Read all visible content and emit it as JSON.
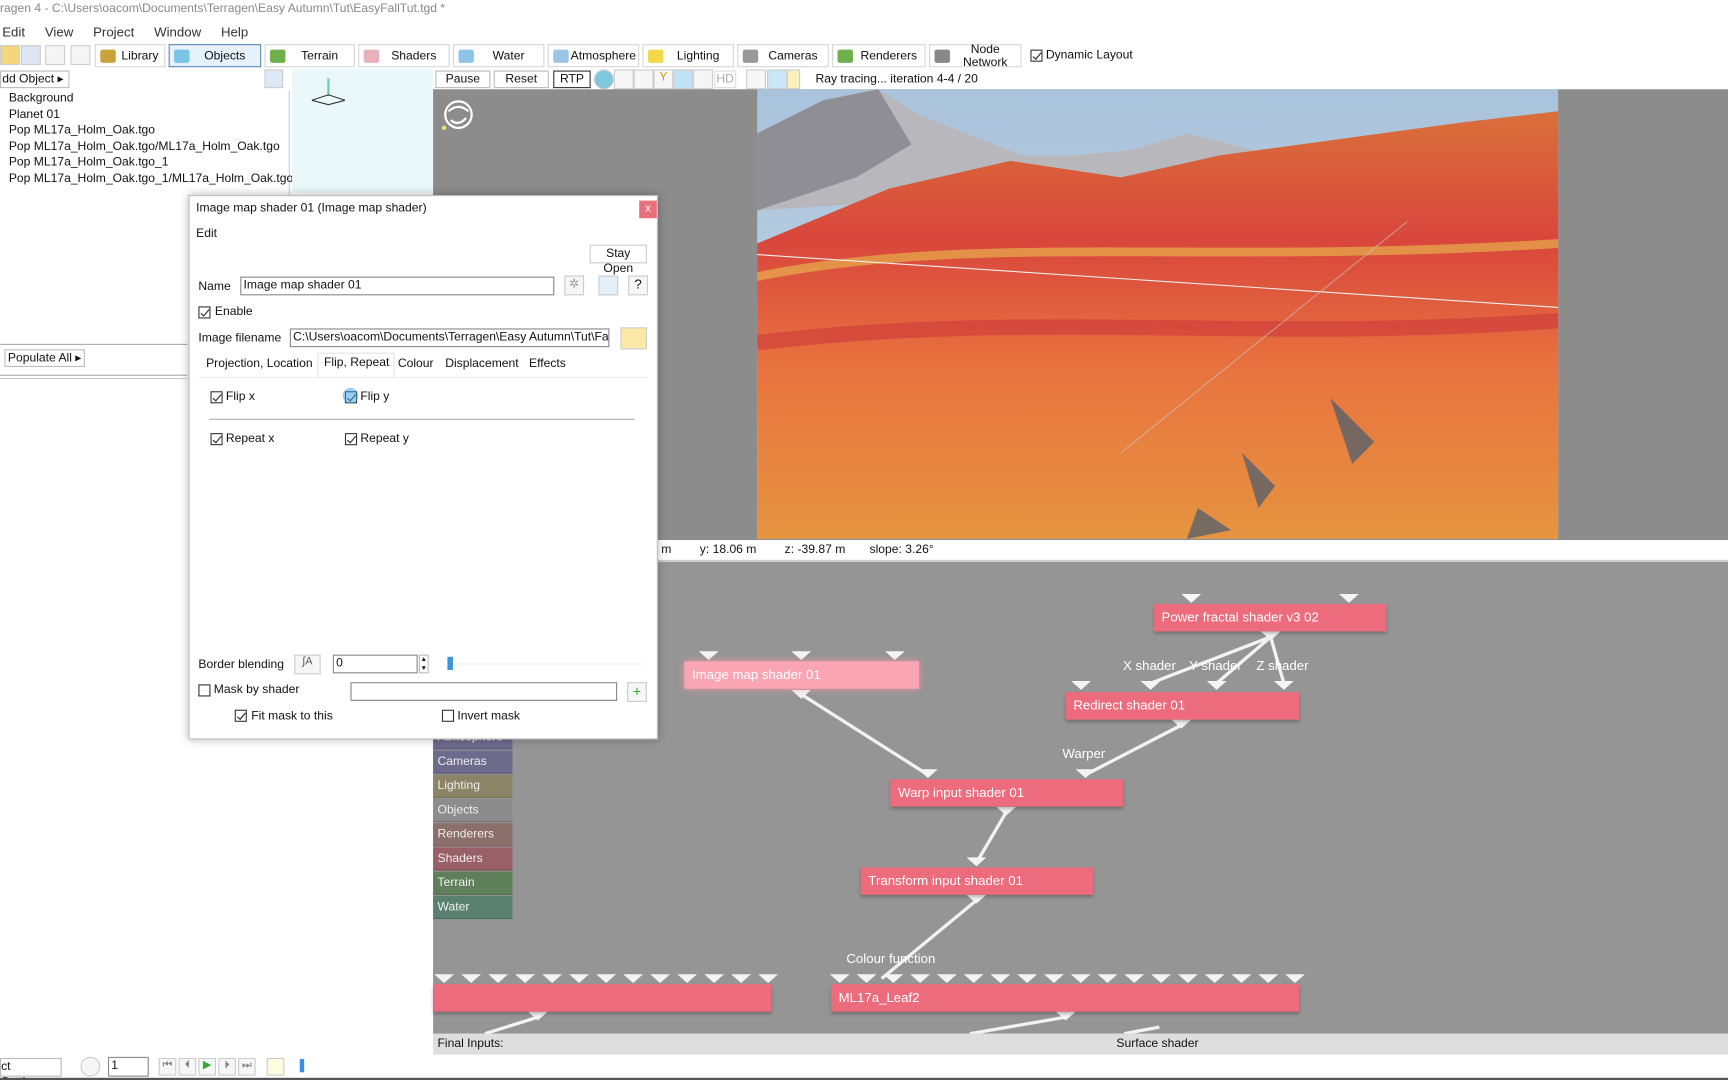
{
  "window_title": "ragen 4 - C:\\Users\\oacom\\Documents\\Terragen\\Easy Autumn\\Tut\\EasyFallTut.tgd *",
  "menu": [
    "Edit",
    "View",
    "Project",
    "Window",
    "Help"
  ],
  "toolbar": {
    "tabs": [
      {
        "label": "Library",
        "icon": "library-icon",
        "color": "#c9a23a"
      },
      {
        "label": "Objects",
        "icon": "cube-icon",
        "color": "#7cc3e8",
        "selected": true
      },
      {
        "label": "Terrain",
        "icon": "terrain-icon",
        "color": "#6fb04a"
      },
      {
        "label": "Shaders",
        "icon": "sphere-icon",
        "color": "#e8b0b8"
      },
      {
        "label": "Water",
        "icon": "water-drop-icon",
        "color": "#8fc4e8"
      },
      {
        "label": "Atmosphere",
        "icon": "sky-icon",
        "color": "#9cc4e4"
      },
      {
        "label": "Lighting",
        "icon": "sun-icon",
        "color": "#f2d84a"
      },
      {
        "label": "Cameras",
        "icon": "camera-icon",
        "color": "#999999"
      },
      {
        "label": "Renderers",
        "icon": "renderer-icon",
        "color": "#6fb04a"
      },
      {
        "label": "Node Network",
        "icon": "node-network-icon",
        "color": "#888888"
      }
    ],
    "dynamic_layout": {
      "label": "Dynamic Layout",
      "checked": true
    }
  },
  "left_panel": {
    "add_object": "dd Object",
    "objects": [
      "Background",
      "Planet 01",
      "Pop ML17a_Holm_Oak.tgo",
      "Pop ML17a_Holm_Oak.tgo/ML17a_Holm_Oak.tgo",
      "Pop ML17a_Holm_Oak.tgo_1",
      "Pop ML17a_Holm_Oak.tgo_1/ML17a_Holm_Oak.tgo"
    ],
    "populate_all": "Populate All"
  },
  "viewport_toolbar": {
    "pause": "Pause",
    "reset": "Reset",
    "rtp": "RTP",
    "hd": "HD",
    "status": "Ray tracing... iteration 4-4 / 20"
  },
  "status_bar": {
    "x": "m",
    "y": "y: 18.06 m",
    "z": "z: -39.87 m",
    "slope": "slope: 3.26°"
  },
  "dialog": {
    "title": "Image map shader 01    (Image map shader)",
    "menu_edit": "Edit",
    "stay_open": "Stay Open",
    "name_label": "Name",
    "name_value": "Image map shader 01",
    "help": "?",
    "enable": {
      "label": "Enable",
      "checked": true
    },
    "image_filename_label": "Image filename",
    "image_filename": "C:\\Users\\oacom\\Documents\\Terragen\\Easy Autumn\\Tut\\Fa",
    "tabs": [
      "Projection, Location",
      "Flip, Repeat",
      "Colour",
      "Displacement",
      "Effects"
    ],
    "active_tab": "Flip, Repeat",
    "flip_x": {
      "label": "Flip x",
      "checked": true
    },
    "flip_y": {
      "label": "Flip y",
      "checked": true
    },
    "repeat_x": {
      "label": "Repeat x",
      "checked": true
    },
    "repeat_y": {
      "label": "Repeat y",
      "checked": true
    },
    "border_blending_label": "Border blending",
    "border_blending_value": "0",
    "mask_by_shader": {
      "label": "Mask by shader",
      "checked": false
    },
    "fit_mask": {
      "label": "Fit mask to this",
      "checked": true
    },
    "invert_mask": {
      "label": "Invert mask",
      "checked": false
    }
  },
  "node_palette": [
    "Atmosphere",
    "Cameras",
    "Lighting",
    "Objects",
    "Renderers",
    "Shaders",
    "Terrain",
    "Water"
  ],
  "node_palette_colors": [
    "#6e6a8c",
    "#6e6a8c",
    "#8c8466",
    "#8c8c8c",
    "#8c6e6a",
    "#9a6068",
    "#5f7f5a",
    "#5a8070"
  ],
  "nodes": {
    "power_fractal": "Power fractal shader v3 02",
    "image_map": "Image map shader 01",
    "redirect": "Redirect shader 01",
    "warp_input": "Warp input shader 01",
    "transform_input": "Transform input shader 01",
    "leaf": "ML17a_Leaf2"
  },
  "node_labels": {
    "x_shader": "X shader",
    "y_shader": "Y shader",
    "z_shader": "Z shader",
    "warper": "Warper",
    "colour_function": "Colour function"
  },
  "final_inputs": {
    "label": "Final Inputs:",
    "surface": "Surface shader"
  },
  "bottom_bar": {
    "settings": "ct Settings...",
    "frame": "1"
  }
}
